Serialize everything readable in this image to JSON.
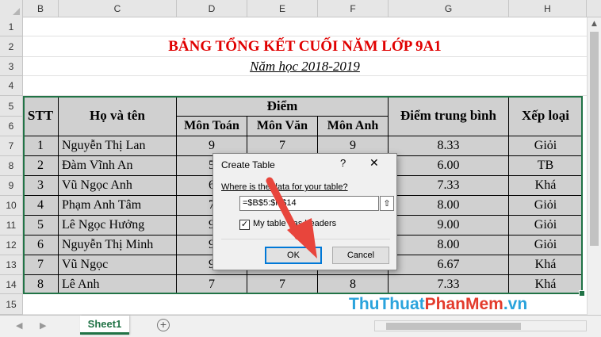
{
  "columns": [
    "B",
    "C",
    "D",
    "E",
    "F",
    "G",
    "H"
  ],
  "rows": [
    "1",
    "2",
    "3",
    "4",
    "5",
    "6",
    "7",
    "8",
    "9",
    "10",
    "11",
    "12",
    "13",
    "14",
    "15"
  ],
  "sheet_title": "BẢNG TỔNG KẾT CUỐI NĂM LỚP 9A1",
  "sheet_subtitle": "Năm học 2018-2019",
  "table": {
    "headers": {
      "stt": "STT",
      "name": "Họ và tên",
      "score_group": "Điểm",
      "math": "Môn Toán",
      "literature": "Môn Văn",
      "english": "Môn Anh",
      "average": "Điểm trung bình",
      "rank": "Xếp loại"
    },
    "rows": [
      {
        "stt": "1",
        "name": "Nguyễn Thị Lan",
        "math": "9",
        "lit": "7",
        "eng": "9",
        "avg": "8.33",
        "rank": "Giỏi"
      },
      {
        "stt": "2",
        "name": "Đàm Vĩnh An",
        "math": "5",
        "lit": "",
        "eng": "",
        "avg": "6.00",
        "rank": "TB"
      },
      {
        "stt": "3",
        "name": "Vũ Ngọc Anh",
        "math": "6",
        "lit": "",
        "eng": "",
        "avg": "7.33",
        "rank": "Khá"
      },
      {
        "stt": "4",
        "name": "Phạm Anh Tâm",
        "math": "7",
        "lit": "",
        "eng": "",
        "avg": "8.00",
        "rank": "Giỏi"
      },
      {
        "stt": "5",
        "name": "Lê Ngọc Hưởng",
        "math": "9",
        "lit": "",
        "eng": "",
        "avg": "9.00",
        "rank": "Giỏi"
      },
      {
        "stt": "6",
        "name": "Nguyễn Thị Minh",
        "math": "9",
        "lit": "",
        "eng": "",
        "avg": "8.00",
        "rank": "Giỏi"
      },
      {
        "stt": "7",
        "name": "Vũ Ngọc",
        "math": "9",
        "lit": "",
        "eng": "",
        "avg": "6.67",
        "rank": "Khá"
      },
      {
        "stt": "8",
        "name": "Lê Anh",
        "math": "7",
        "lit": "7",
        "eng": "8",
        "avg": "7.33",
        "rank": "Khá"
      }
    ]
  },
  "dialog": {
    "title": "Create Table",
    "help": "?",
    "close": "✕",
    "prompt": "Where is the data for your table?",
    "range_value": "=$B$5:$H$14",
    "collapse_icon": "⇧",
    "checkbox_checked": "✓",
    "checkbox_label": "My table has headers",
    "ok_label": "OK",
    "cancel_label": "Cancel"
  },
  "sheet_tab": "Sheet1",
  "add_sheet": "+",
  "nav_prev": "◀",
  "nav_next": "▶",
  "scroll_up": "▲",
  "watermark": {
    "part1": "ThuThuat",
    "part2": "PhanMem",
    "part3": ".vn"
  },
  "colors": {
    "accent": "#217346",
    "title_red": "#e00000",
    "arrow": "#e8453c"
  }
}
